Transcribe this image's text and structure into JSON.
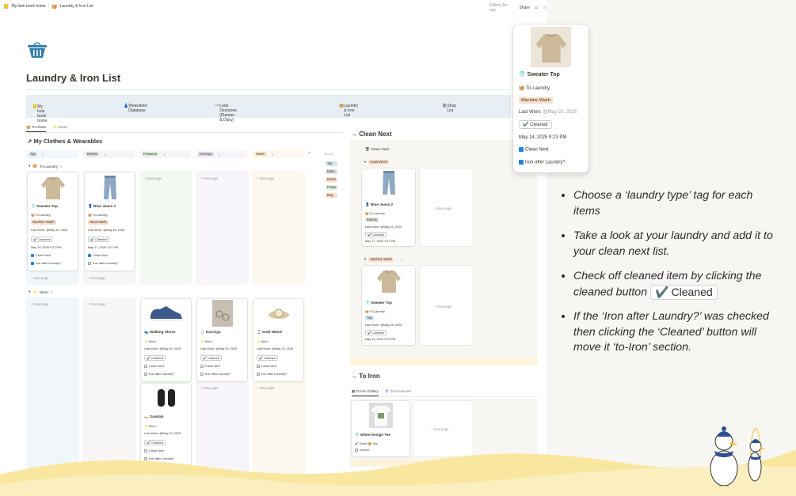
{
  "breadcrumb": {
    "home": "My look book home",
    "sep": "/",
    "current": "Laundry & Iron List"
  },
  "topbar": {
    "edited": "Edited 3m ago",
    "share": "Share"
  },
  "page": {
    "title": "Laundry & Iron List"
  },
  "nav": [
    "My look book home",
    "Wearables Database",
    "Look Decisions (Planner & Diary)",
    "Laundry & Iron List",
    "Shop List"
  ],
  "tabs": [
    "To Clean",
    "Clean"
  ],
  "board": {
    "title": "My Clothes & Wearables",
    "columns": [
      {
        "name": "Top",
        "count": "1"
      },
      {
        "name": "Bottom",
        "count": "1"
      },
      {
        "name": "Footwear",
        "count": "2"
      },
      {
        "name": "Earrings",
        "count": "1"
      },
      {
        "name": "Watch",
        "count": "1"
      }
    ],
    "hidden_label": "Pinned",
    "hidden_tags": [
      "Top",
      "Botto",
      "Dress",
      "Footw",
      "Bag"
    ],
    "groups": [
      {
        "name": "To-Laundry",
        "count": "2"
      },
      {
        "name": "Worn",
        "count": "4"
      }
    ],
    "new_page": "+ New page",
    "laundry_cards": [
      {
        "title": "Sweater Top",
        "status": "To-Laundry",
        "type": "Machine Wash",
        "last_worn": "Last Worn: @May 16, 2025",
        "cleaned": "Cleaned",
        "date": "May 14, 2025 9:23 PM",
        "clean_next": "Clean Next",
        "iron": "Iron after Laundry?"
      },
      {
        "title": "Blue Jeans 2",
        "status": "To-Laundry",
        "type": "Hand Wash",
        "last_worn": "Last Worn: @May 16, 2025",
        "cleaned": "Cleaned",
        "date": "May 17, 2025 1:57 PM",
        "clean_next": "Clean Next",
        "iron": "Iron after Laundry?"
      }
    ],
    "worn_cards": [
      {
        "title": "Walking Shoes",
        "status": "Worn",
        "last_worn": "Last Worn: @May 16, 2025",
        "cleaned": "Cleaned",
        "clean_next": "Clean Next",
        "iron": "Iron after Laundry?"
      },
      {
        "title": "Sandals",
        "status": "Worn",
        "last_worn": "Last Worn: @May 10, 2025",
        "cleaned": "Cleaned",
        "clean_next": "Clean Next",
        "iron": "Iron after Laundry?"
      },
      {
        "title": "Earrings",
        "status": "Worn",
        "last_worn": "Last Worn: @May 16, 2025",
        "cleaned": "Cleaned",
        "clean_next": "Clean Next",
        "iron": "Iron after Laundry?"
      },
      {
        "title": "Gold Watch",
        "status": "Worn",
        "last_worn": "Last Worn: @May 16, 2025",
        "cleaned": "Cleaned",
        "clean_next": "Clean Next",
        "iron": "Iron after Laundry?"
      }
    ]
  },
  "clean_next": {
    "title": "Clean Next",
    "filter": "Clean Next:",
    "groups": [
      {
        "name": "Hand Wash"
      },
      {
        "name": "Machine Wash"
      }
    ],
    "cards": [
      {
        "title": "Blue Jeans 2",
        "status": "To-Laundry",
        "cat": "Bottom",
        "last_worn": "Last Worn: @May 16, 2025",
        "cleaned": "Cleaned",
        "date": "May 17, 2025 1:57 PM"
      },
      {
        "title": "Sweater Top",
        "status": "To-Laundry",
        "cat": "Top",
        "last_worn": "Last Worn: @May 16, 2025",
        "cleaned": "Cleaned",
        "date": "May 14, 2025 9:23 PM"
      }
    ],
    "new_page": "+ New page"
  },
  "to_iron": {
    "title": "To Iron",
    "tabs": [
      "To Iron Gallery",
      "To Iron Board"
    ],
    "card": {
      "title": "White Design Tee",
      "status": "Clean",
      "iron_tag": "Iron",
      "ironed": "Ironed?"
    },
    "new_page": "+ New page"
  },
  "popup": {
    "title": "Sweater Top",
    "status": "To-Laundry",
    "type": "Machine Wash",
    "last_worn_label": "Last Worn:",
    "last_worn": "@May 20, 2025",
    "cleaned": "Cleaned",
    "date": "May 14, 2025 9:23 PM",
    "clean_next": "Clean Next",
    "iron": "Iron after Laundry?"
  },
  "instructions": {
    "b1": "Choose a ‘laundry type’ tag for each items",
    "b2": "Take a look at your laundry and add it to your clean next list.",
    "b3": "Check off cleaned item by clicking the cleaned button",
    "b3_button": "Cleaned",
    "b4": "If the ‘Iron after Laundry?’ was checked then clicking the ‘Cleaned’ button will move it ‘to-Iron’ section."
  },
  "colors": {
    "nav_bg": "#e7eef4",
    "accent_blue": "#2383e2",
    "wave_yellow": "#f9e79f",
    "tag_top": "#d3e5ef",
    "tag_bottom": "#e3e2e0",
    "tag_footwear": "#dbeddb",
    "tag_earrings": "#e8deee",
    "tag_watch": "#fdecc8",
    "tag_machine": "#fadec9"
  }
}
